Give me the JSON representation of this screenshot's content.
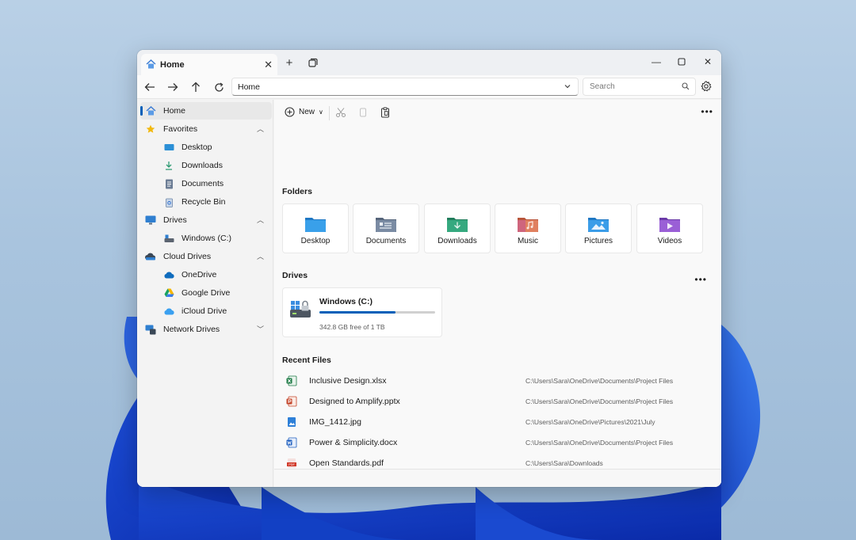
{
  "tab": {
    "label": "Home"
  },
  "address": {
    "path": "Home"
  },
  "search": {
    "placeholder": "Search"
  },
  "sidebar": {
    "home": "Home",
    "favorites": {
      "label": "Favorites",
      "items": [
        "Desktop",
        "Downloads",
        "Documents",
        "Recycle Bin"
      ]
    },
    "drives": {
      "label": "Drives",
      "items": [
        "Windows (C:)"
      ]
    },
    "cloud": {
      "label": "Cloud Drives",
      "items": [
        "OneDrive",
        "Google Drive",
        "iCloud Drive"
      ]
    },
    "network": {
      "label": "Network Drives"
    }
  },
  "commandbar": {
    "new_label": "New"
  },
  "sections": {
    "folders": "Folders",
    "drives": "Drives",
    "recent": "Recent Files"
  },
  "folders": [
    {
      "label": "Desktop",
      "color": "#2b8fd6"
    },
    {
      "label": "Documents",
      "color": "#6c7d95"
    },
    {
      "label": "Downloads",
      "color": "#2e9b73"
    },
    {
      "label": "Music",
      "color": "#d9735a"
    },
    {
      "label": "Pictures",
      "color": "#2d8fd8"
    },
    {
      "label": "Videos",
      "color": "#8a52c8"
    }
  ],
  "drive": {
    "name": "Windows (C:)",
    "free": "342.8 GB free of 1 TB",
    "used_fraction": 0.66
  },
  "recent": [
    {
      "name": "Inclusive Design.xlsx",
      "path": "C:\\Users\\Sara\\OneDrive\\Documents\\Project Files",
      "icon": "excel-icon"
    },
    {
      "name": "Designed to Amplify.pptx",
      "path": "C:\\Users\\Sara\\OneDrive\\Documents\\Project Files",
      "icon": "powerpoint-icon"
    },
    {
      "name": "IMG_1412.jpg",
      "path": "C:\\Users\\Sara\\OneDrive\\Pictures\\2021\\July",
      "icon": "image-file-icon"
    },
    {
      "name": "Power & Simplicity.docx",
      "path": "C:\\Users\\Sara\\OneDrive\\Documents\\Project Files",
      "icon": "word-icon"
    },
    {
      "name": "Open Standards.pdf",
      "path": "C:\\Users\\Sara\\Downloads",
      "icon": "pdf-icon"
    }
  ],
  "colors": {
    "accent": "#005fb8"
  }
}
